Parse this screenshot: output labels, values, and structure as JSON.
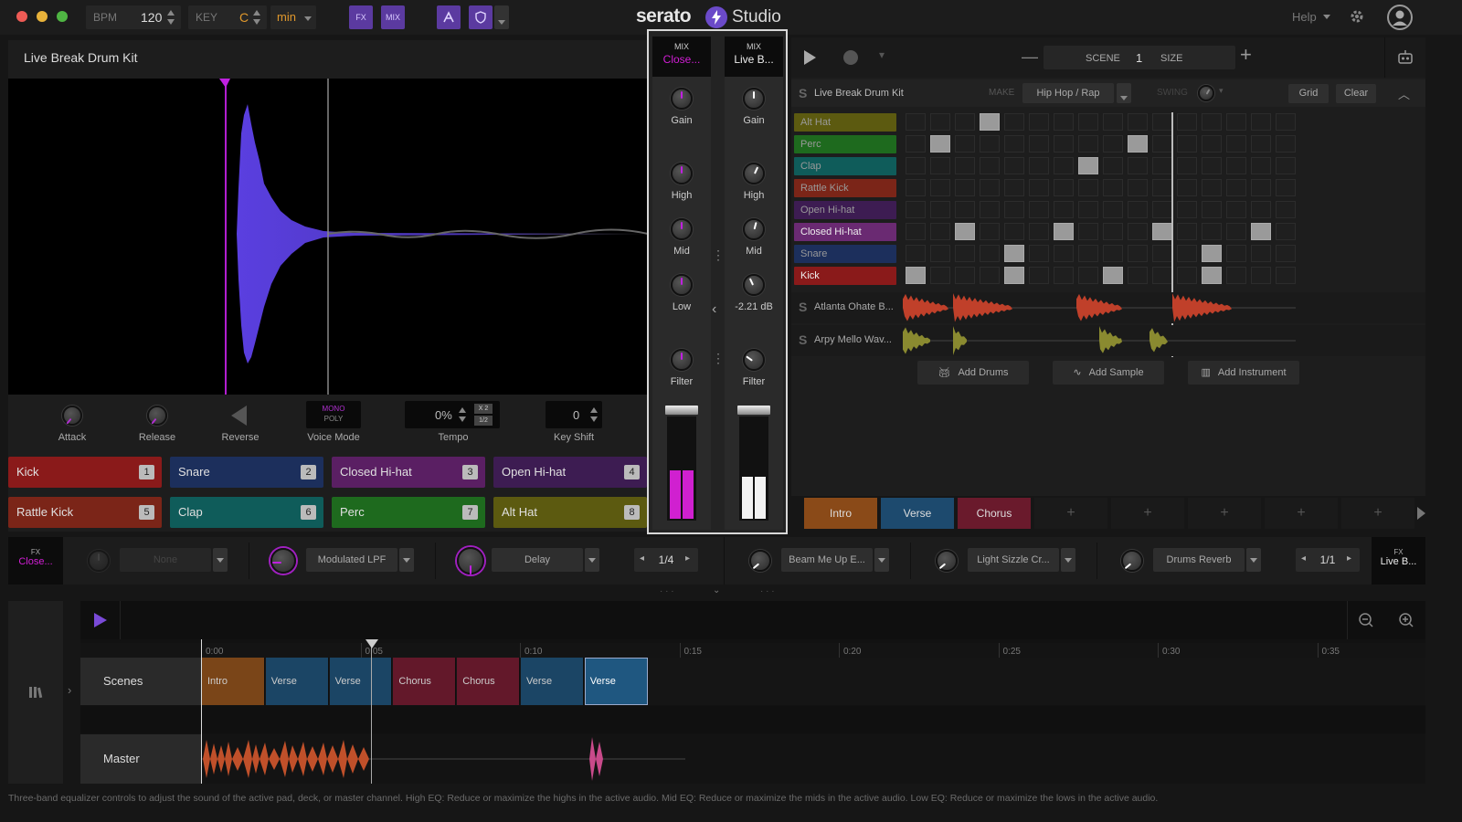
{
  "titlebar": {
    "bpm_label": "BPM",
    "bpm_value": "120",
    "key_label": "KEY",
    "key_value": "C",
    "scale_value": "min",
    "fx_button": "FX",
    "mix_button": "MIX",
    "logo_text": "serato",
    "studio_text": "Studio",
    "help_label": "Help"
  },
  "sampler": {
    "title": "Live Break Drum Kit",
    "controls": {
      "attack": "Attack",
      "release": "Release",
      "reverse": "Reverse",
      "voice_mode": "Voice Mode",
      "mono": "MONO",
      "poly": "POLY",
      "tempo": "Tempo",
      "tempo_value": "0%",
      "x2": "X 2",
      "half": "1/2",
      "key_shift": "Key Shift",
      "key_shift_value": "0"
    },
    "pads": [
      {
        "label": "Kick",
        "num": "1",
        "color": "#8a1a1a"
      },
      {
        "label": "Snare",
        "num": "2",
        "color": "#1c2f5c"
      },
      {
        "label": "Closed Hi-hat",
        "num": "3",
        "color": "#5a1f63"
      },
      {
        "label": "Open Hi-hat",
        "num": "4",
        "color": "#3d1c52"
      },
      {
        "label": "Rattle Kick",
        "num": "5",
        "color": "#7b2518"
      },
      {
        "label": "Clap",
        "num": "6",
        "color": "#0f5c5a"
      },
      {
        "label": "Perc",
        "num": "7",
        "color": "#1e6a1e"
      },
      {
        "label": "Alt Hat",
        "num": "8",
        "color": "#5c5a10"
      }
    ]
  },
  "mixer": {
    "left": {
      "mix": "MIX",
      "name": "Close...",
      "gain": "Gain",
      "high": "High",
      "mid": "Mid",
      "low": "Low",
      "filter": "Filter",
      "level": 0.48
    },
    "right": {
      "mix": "MIX",
      "name": "Live B...",
      "gain": "Gain",
      "high": "High",
      "mid": "Mid",
      "db": "-2.21 dB",
      "filter": "Filter",
      "level": 0.42
    }
  },
  "sequencer": {
    "scene_label": "SCENE",
    "scene_value": "1",
    "size_label": "SIZE",
    "kit_name": "Live Break Drum Kit",
    "make_label": "MAKE",
    "genre": "Hip Hop / Rap",
    "swing_label": "SWING",
    "grid_button": "Grid",
    "clear_button": "Clear",
    "lanes": [
      {
        "label": "Alt Hat",
        "color": "#5c5a10",
        "steps": [
          3
        ]
      },
      {
        "label": "Perc",
        "color": "#1e6a1e",
        "steps": [
          1,
          9
        ]
      },
      {
        "label": "Clap",
        "color": "#0f5c5a",
        "steps": [
          7
        ]
      },
      {
        "label": "Rattle Kick",
        "color": "#7b2518",
        "steps": []
      },
      {
        "label": "Open Hi-hat",
        "color": "#3d1c52",
        "steps": []
      },
      {
        "label": "Closed Hi-hat",
        "color": "#6a2a72",
        "steps": [
          2,
          6,
          10,
          14
        ]
      },
      {
        "label": "Snare",
        "color": "#1c2f5c",
        "steps": [
          4,
          12
        ]
      },
      {
        "label": "Kick",
        "color": "#8a1a1a",
        "steps": [
          0,
          4,
          8,
          12
        ]
      }
    ],
    "samples": [
      {
        "label": "Atlanta Ohate B..."
      },
      {
        "label": "Arpy Mello Wav..."
      }
    ],
    "add_drums": "Add Drums",
    "add_sample": "Add Sample",
    "add_instrument": "Add Instrument",
    "scenes": [
      {
        "label": "Intro",
        "color": "#8a4a18"
      },
      {
        "label": "Verse",
        "color": "#1d4a6e"
      },
      {
        "label": "Chorus",
        "color": "#6a1a2c"
      },
      {
        "label": "+",
        "color": "#1a1a1a"
      },
      {
        "label": "+",
        "color": "#1a1a1a"
      },
      {
        "label": "+",
        "color": "#1a1a1a"
      },
      {
        "label": "+",
        "color": "#1a1a1a"
      },
      {
        "label": "+",
        "color": "#1a1a1a"
      }
    ]
  },
  "fx": {
    "left_label": "FX",
    "left_name": "Close...",
    "slots_left": [
      "None",
      "Modulated LPF",
      "Delay"
    ],
    "left_rate": "1/4",
    "slots_right": [
      "Beam Me Up E...",
      "Light Sizzle Cr...",
      "Drums Reverb"
    ],
    "right_rate": "1/1",
    "right_label": "FX",
    "right_name": "Live B..."
  },
  "timeline": {
    "ticks": [
      "0:00",
      "0:05",
      "0:10",
      "0:15",
      "0:20",
      "0:25",
      "0:30",
      "0:35"
    ],
    "scenes_label": "Scenes",
    "master_label": "Master",
    "clips": [
      {
        "label": "Intro",
        "color": "#7a4518"
      },
      {
        "label": "Verse",
        "color": "#1b4565"
      },
      {
        "label": "Verse",
        "color": "#1b4565"
      },
      {
        "label": "Chorus",
        "color": "#63182a"
      },
      {
        "label": "Chorus",
        "color": "#63182a"
      },
      {
        "label": "Verse",
        "color": "#1b4565"
      },
      {
        "label": "Verse",
        "color": "#1f5780"
      }
    ]
  },
  "status": "Three-band equalizer controls to adjust the sound of the active pad, deck, or master channel. High EQ: Reduce or maximize the highs in the active audio. Mid EQ: Reduce or maximize the mids in the active audio. Low EQ: Reduce or maximize the lows in the active audio."
}
